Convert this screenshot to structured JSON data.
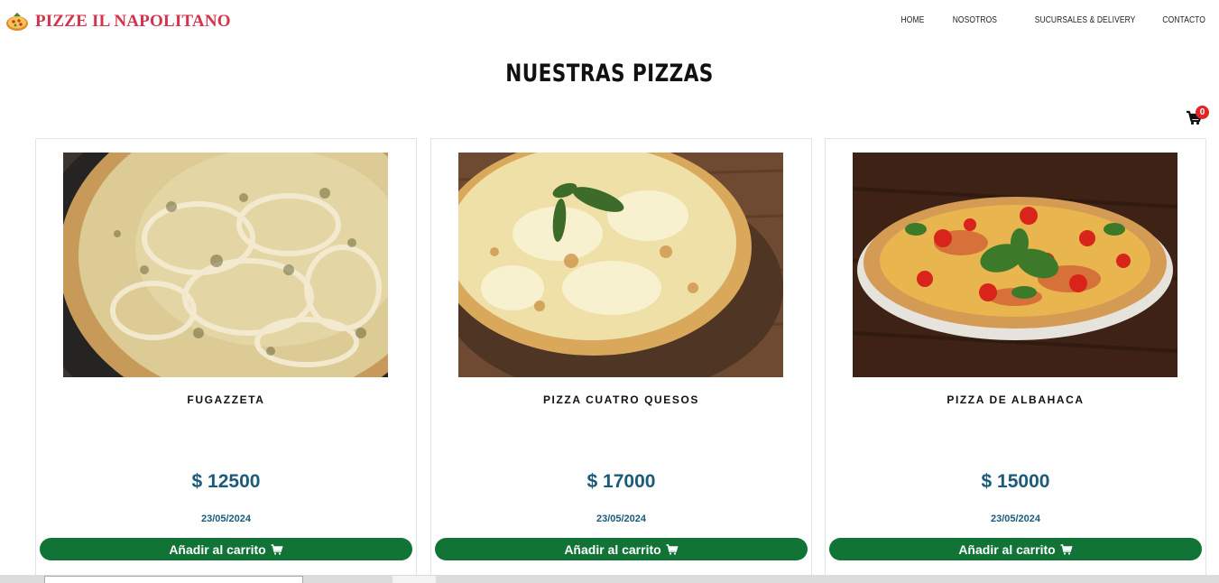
{
  "brand": {
    "name": "PIZZE IL NAPOLITANO",
    "logo_icon": "pizza-logo-icon",
    "color": "#d6314d"
  },
  "nav": {
    "items": [
      {
        "label": "HOME"
      },
      {
        "label": "NOSOTROS"
      },
      {
        "label": "SUCURSALES & DELIVERY"
      },
      {
        "label": "CONTACTO"
      }
    ]
  },
  "page": {
    "title": "NUESTRAS PIZZAS"
  },
  "cart": {
    "icon": "cart-icon",
    "count": "0"
  },
  "products": [
    {
      "name": "FUGAZZETA",
      "price": "$ 12500",
      "date": "23/05/2024",
      "button": "Añadir al carrito",
      "image_icon": "fugazzeta-pizza-image"
    },
    {
      "name": "PIZZA CUATRO QUESOS",
      "price": "$ 17000",
      "date": "23/05/2024",
      "button": "Añadir al carrito",
      "image_icon": "cuatro-quesos-pizza-image"
    },
    {
      "name": "PIZZA DE ALBAHACA",
      "price": "$ 15000",
      "date": "23/05/2024",
      "button": "Añadir al carrito",
      "image_icon": "albahaca-pizza-image"
    }
  ],
  "colors": {
    "price": "#1b5a78",
    "button": "#117336",
    "badge": "#e12424"
  }
}
